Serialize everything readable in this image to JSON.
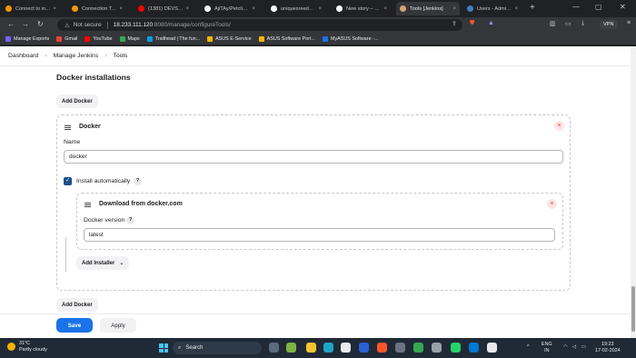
{
  "browser": {
    "tabs": [
      {
        "label": "Connect to instance",
        "color": "#f29900",
        "active": false
      },
      {
        "label": "Connection Timeout",
        "color": "#f29900",
        "active": false
      },
      {
        "label": "(1381) DEVSECOPS P",
        "color": "#ff0000",
        "active": false
      },
      {
        "label": "AjiTAy/Petclinic-Real",
        "color": "#ffffff",
        "active": false
      },
      {
        "label": "uniquesreedhar/Java",
        "color": "#ffffff",
        "active": false
      },
      {
        "label": "New story – Medium",
        "color": "#ffffff",
        "active": false
      },
      {
        "label": "Tools [Jenkins]",
        "color": "#d4a373",
        "active": true
      },
      {
        "label": "Users - Administratio",
        "color": "#3b82c4",
        "active": false
      }
    ],
    "address": {
      "security": "Not secure",
      "host": "18.233.111.120",
      "path": ":8080/manage/configureTools/"
    },
    "vpn_label": "VPN",
    "bookmarks": [
      {
        "label": "Manage Exports",
        "color": "#7b61ff"
      },
      {
        "label": "Gmail",
        "color": "#ea4335"
      },
      {
        "label": "YouTube",
        "color": "#ff0000"
      },
      {
        "label": "Maps",
        "color": "#34a853"
      },
      {
        "label": "Trailhead | The fun...",
        "color": "#00a1e0"
      },
      {
        "label": "ASUS E-Service",
        "color": "#f2b705"
      },
      {
        "label": "ASUS Software Port...",
        "color": "#f2b705"
      },
      {
        "label": "MyASUS Software -...",
        "color": "#1a73e8"
      }
    ]
  },
  "breadcrumb": [
    "Dashboard",
    "Manage Jenkins",
    "Tools"
  ],
  "section": {
    "title": "Docker installations",
    "add_docker_label": "Add Docker"
  },
  "docker_card": {
    "title": "Docker",
    "name_label": "Name",
    "name_value": "docker",
    "install_auto_label": "Install automatically",
    "help_glyph": "?",
    "installer": {
      "title": "Download from docker.com",
      "version_label": "Docker version",
      "version_value": "latest"
    },
    "add_installer_label": "Add Installer",
    "close_glyph": "×"
  },
  "footer": {
    "add_docker_label": "Add Docker",
    "save_label": "Save",
    "apply_label": "Apply"
  },
  "taskbar": {
    "temperature": "31°C",
    "weather": "Partly cloudy",
    "search_label": "Search",
    "lang_top": "ENG",
    "lang_bottom": "IN",
    "time": "19:23",
    "date": "17-02-2024"
  }
}
